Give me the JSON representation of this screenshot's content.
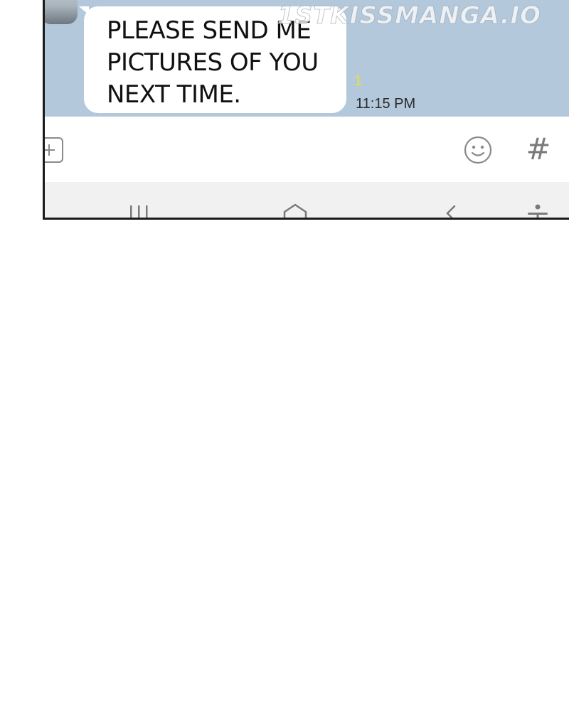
{
  "chat": {
    "message": "PLEASE SEND ME\nPICTURES OF YOU\nNEXT TIME.",
    "unread_count": "1",
    "timestamp": "11:15 PM"
  },
  "watermark": "1STKISSMANGA.IO",
  "input_bar": {
    "attach_icon": "plus-square-icon",
    "emoji_icon": "smiley-icon",
    "hashtag_icon": "hash-icon",
    "hashtag_label": "#"
  },
  "nav_bar": {
    "icons": [
      "recent-apps-icon",
      "home-icon",
      "back-icon",
      "accessibility-icon"
    ]
  },
  "colors": {
    "chat_background": "#b4c8dc",
    "bubble": "#ffffff",
    "unread": "#f2e31a",
    "nav_background": "#f1f1f1"
  }
}
